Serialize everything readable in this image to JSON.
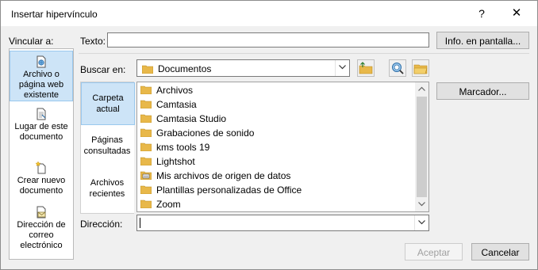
{
  "window": {
    "title": "Insertar hipervínculo",
    "help_label": "?",
    "close_label": "✕"
  },
  "link_to": {
    "label": "Vincular a:",
    "items": [
      {
        "label_line1": "Archivo o",
        "label_line2": "página web",
        "label_line3": "existente",
        "icon": "web-file-icon",
        "active": true
      },
      {
        "label_line1": "Lugar de este",
        "label_line2": "documento",
        "icon": "document-place-icon"
      },
      {
        "label_line1": "Crear nuevo",
        "label_line2": "documento",
        "icon": "new-document-icon"
      },
      {
        "label_line1": "Dirección de",
        "label_line2": "correo",
        "label_line3": "electrónico",
        "icon": "email-icon"
      }
    ]
  },
  "text_field": {
    "label": "Texto:",
    "value": ""
  },
  "screentip_button": "Info. en pantalla...",
  "look_in": {
    "label": "Buscar en:",
    "value": "Documentos",
    "icon": "folder-icon"
  },
  "toolbar_icons": [
    "folder-up-icon",
    "browse-web-icon",
    "browse-file-icon"
  ],
  "places": [
    {
      "line1": "Carpeta",
      "line2": "actual",
      "active": true
    },
    {
      "line1": "Páginas",
      "line2": "consultadas"
    },
    {
      "line1": "Archivos",
      "line2": "recientes"
    }
  ],
  "files": [
    {
      "name": "Archivos",
      "icon": "folder-icon"
    },
    {
      "name": "Camtasia",
      "icon": "folder-icon"
    },
    {
      "name": "Camtasia Studio",
      "icon": "folder-icon"
    },
    {
      "name": "Grabaciones de sonido",
      "icon": "folder-icon"
    },
    {
      "name": "kms tools 19",
      "icon": "folder-icon"
    },
    {
      "name": "Lightshot",
      "icon": "folder-icon"
    },
    {
      "name": "Mis archivos de origen de datos",
      "icon": "data-source-folder-icon"
    },
    {
      "name": "Plantillas personalizadas de Office",
      "icon": "folder-icon"
    },
    {
      "name": "Zoom",
      "icon": "folder-icon"
    }
  ],
  "bookmark_button": "Marcador...",
  "address": {
    "label": "Dirección:",
    "value": ""
  },
  "ok_button": "Aceptar",
  "cancel_button": "Cancelar",
  "colors": {
    "active_bg": "#cde4f7",
    "active_border": "#99c8ee",
    "folder": "#e8b84a",
    "dialog_bg": "#f0f0f0"
  }
}
